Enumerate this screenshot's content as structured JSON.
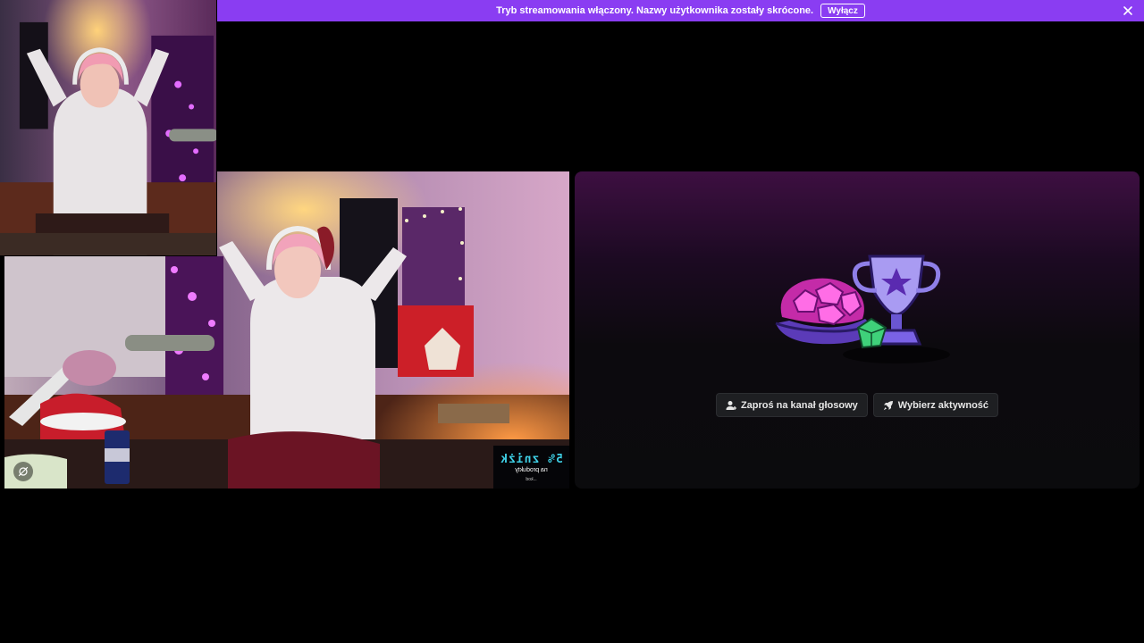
{
  "notice": {
    "message": "Tryb streamowania włączony. Nazwy użytkownika zostały skrócone.",
    "disable_label": "Wyłącz",
    "accent_color": "#8a3df2"
  },
  "pip_video": {
    "scene": "woman-with-headphones-in-decorated-room"
  },
  "main_video": {
    "scene": "woman-with-headphones-in-decorated-room",
    "overlay_text_main": "5% zniżk",
    "overlay_text_sub": "na produkty",
    "overlay_text_tiny": "...kod"
  },
  "activity": {
    "invite_label": "Zaproś na kanał głosowy",
    "activity_label": "Wybierz aktywność",
    "icons": {
      "invite": "person-add-icon",
      "activity": "rocket-icon"
    }
  }
}
